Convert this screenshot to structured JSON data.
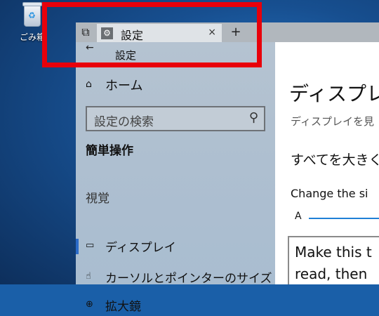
{
  "desktop": {
    "recycle_label": "ごみ箱"
  },
  "tab": {
    "title": "設定",
    "close_glyph": "×",
    "new_tab_glyph": "+"
  },
  "settings": {
    "back_glyph": "←",
    "app_title": "設定",
    "home_label": "ホーム",
    "search_placeholder": "設定の検索",
    "section_heading": "簡単操作",
    "group_heading": "視覚",
    "nav_items": [
      {
        "label": "ディスプレイ",
        "icon": "monitor-icon",
        "selected": true
      },
      {
        "label": "カーソルとポインターのサイズ",
        "icon": "pointer-icon",
        "selected": false
      },
      {
        "label": "拡大鏡",
        "icon": "magnifier-icon",
        "selected": false
      }
    ]
  },
  "content": {
    "heading": "ディスプレイ",
    "description": "ディスプレイを見",
    "subheading": "すべてを大きく",
    "change_label": "Change the si",
    "slider_label": "A",
    "sample_line1": "Make this t",
    "sample_line2": "read, then"
  },
  "colors": {
    "highlight": "#e8000b",
    "accent": "#2a6bc8"
  }
}
